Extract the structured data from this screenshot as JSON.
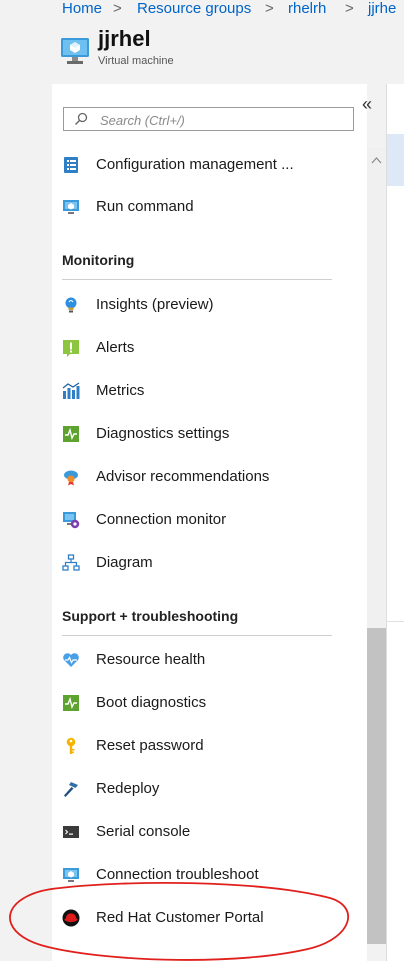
{
  "breadcrumb": {
    "items": [
      "Home",
      "Resource groups",
      "rhelrh",
      "jjrhe"
    ],
    "separator": ">"
  },
  "resource": {
    "name": "jjrhel",
    "type": "Virtual machine"
  },
  "search": {
    "placeholder": "Search (Ctrl+/)"
  },
  "collapse_label": "«",
  "menu": {
    "top_items": [
      {
        "label": "Configuration management ...",
        "icon": "config-list-icon"
      },
      {
        "label": "Run command",
        "icon": "run-command-icon"
      }
    ],
    "monitoring": {
      "title": "Monitoring",
      "items": [
        {
          "label": "Insights (preview)",
          "icon": "lightbulb-icon"
        },
        {
          "label": "Alerts",
          "icon": "alert-icon"
        },
        {
          "label": "Metrics",
          "icon": "metrics-icon"
        },
        {
          "label": "Diagnostics settings",
          "icon": "diagnostics-icon"
        },
        {
          "label": "Advisor recommendations",
          "icon": "advisor-icon"
        },
        {
          "label": "Connection monitor",
          "icon": "connection-monitor-icon"
        },
        {
          "label": "Diagram",
          "icon": "diagram-icon"
        }
      ]
    },
    "support": {
      "title": "Support + troubleshooting",
      "items": [
        {
          "label": "Resource health",
          "icon": "heart-icon"
        },
        {
          "label": "Boot diagnostics",
          "icon": "boot-diagnostics-icon"
        },
        {
          "label": "Reset password",
          "icon": "key-icon"
        },
        {
          "label": "Redeploy",
          "icon": "hammer-icon"
        },
        {
          "label": "Serial console",
          "icon": "terminal-icon"
        },
        {
          "label": "Connection troubleshoot",
          "icon": "troubleshoot-icon"
        },
        {
          "label": "Red Hat Customer Portal",
          "icon": "red-hat-icon"
        }
      ]
    }
  },
  "colors": {
    "link": "#0064c8",
    "annotation": "#e0201c",
    "accent": "#0078d4"
  }
}
